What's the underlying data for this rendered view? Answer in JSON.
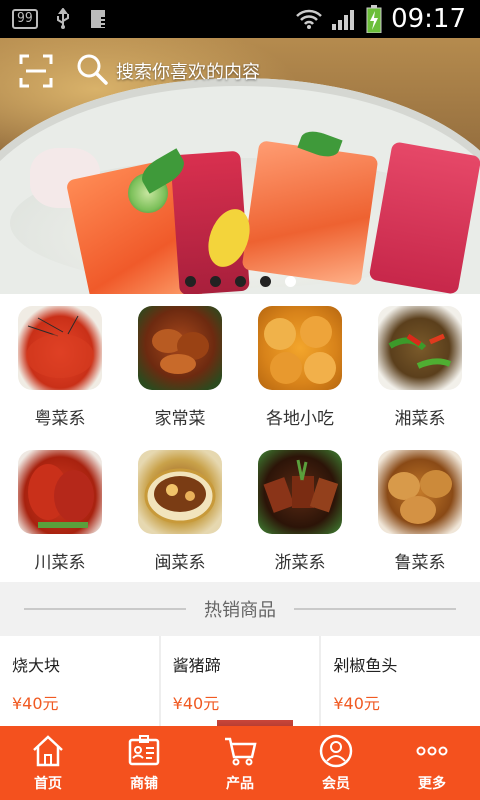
{
  "status_bar": {
    "badge": "99",
    "time": "09:17",
    "icons": [
      "notification-badge-icon",
      "usb-icon",
      "download-icon",
      "wifi-icon",
      "signal-icon",
      "battery-charging-icon"
    ]
  },
  "topbar": {
    "search_placeholder": "搜索你喜欢的内容",
    "icons": [
      "scan-icon",
      "search-icon"
    ]
  },
  "banner": {
    "slide_count": 5,
    "active_index": 4
  },
  "categories": [
    {
      "label": "粤菜系",
      "icon": "shrimp-image"
    },
    {
      "label": "家常菜",
      "icon": "braised-pork-image"
    },
    {
      "label": "各地小吃",
      "icon": "fried-pastry-image"
    },
    {
      "label": "湘菜系",
      "icon": "stir-fry-image"
    },
    {
      "label": "川菜系",
      "icon": "pig-trotter-image"
    },
    {
      "label": "闽菜系",
      "icon": "buddha-jumps-wall-image"
    },
    {
      "label": "浙菜系",
      "icon": "dongpo-pork-image"
    },
    {
      "label": "鲁菜系",
      "icon": "abalone-image"
    }
  ],
  "hot_section": {
    "title": "热销商品"
  },
  "products": [
    {
      "name": "烧大块",
      "price": "¥40元"
    },
    {
      "name": "酱猪蹄",
      "price": "¥40元"
    },
    {
      "name": "剁椒鱼头",
      "price": "¥40元"
    }
  ],
  "bottom_nav": [
    {
      "label": "首页",
      "icon": "home-icon"
    },
    {
      "label": "商铺",
      "icon": "shop-card-icon"
    },
    {
      "label": "产品",
      "icon": "cart-icon"
    },
    {
      "label": "会员",
      "icon": "member-icon"
    },
    {
      "label": "更多",
      "icon": "more-dots-icon"
    }
  ],
  "colors": {
    "accent": "#f4511e",
    "price": "#f05a22",
    "background": "#f2f2f2"
  }
}
